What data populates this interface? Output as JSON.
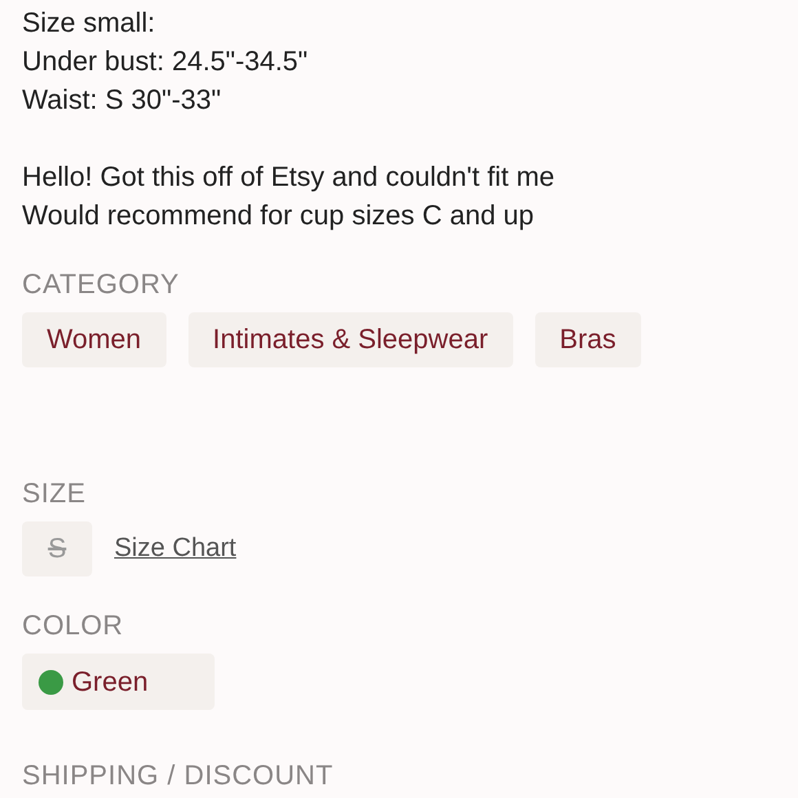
{
  "description": {
    "paragraphs": [
      [
        "Size small:",
        "Under bust: 24.5\"-34.5\"",
        "Waist: S 30\"-33\""
      ],
      [
        "Hello! Got this off of Etsy and couldn't fit me",
        "Would recommend for cup sizes C and up"
      ]
    ]
  },
  "category": {
    "heading": "CATEGORY",
    "tags": [
      "Women",
      "Intimates & Sleepwear",
      "Bras"
    ]
  },
  "size": {
    "heading": "SIZE",
    "options": [
      {
        "label": "S",
        "available": false
      }
    ],
    "size_chart_link": "Size Chart"
  },
  "color": {
    "heading": "COLOR",
    "options": [
      {
        "label": "Green",
        "color": "#3a9a45"
      }
    ]
  },
  "shipping": {
    "heading": "SHIPPING / DISCOUNT"
  }
}
